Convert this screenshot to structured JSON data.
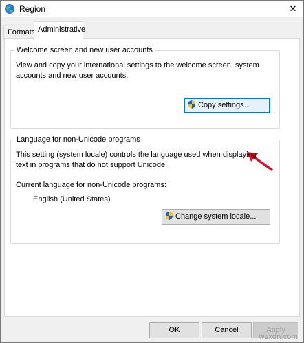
{
  "window": {
    "title": "Region"
  },
  "tabs": [
    {
      "label": "Formats"
    },
    {
      "label": "Administrative"
    }
  ],
  "welcome": {
    "legend": "Welcome screen and new user accounts",
    "description_line1": "View and copy your international settings to the welcome screen, system",
    "description_line2": "accounts and new user accounts.",
    "copy_button_label": "Copy settings..."
  },
  "language": {
    "legend": "Language for non-Unicode programs",
    "description_line1": "This setting (system locale) controls the language used when displaying",
    "description_line2": "text in programs that do not support Unicode.",
    "current_label": "Current language for non-Unicode programs:",
    "current_value": "English (United States)",
    "change_button_label": "Change system locale..."
  },
  "footer": {
    "ok_label": "OK",
    "cancel_label": "Cancel",
    "apply_label": "Apply"
  },
  "watermark": "wsxdn.com",
  "colors": {
    "accent": "#0078d7",
    "annotation_arrow": "#e0102a"
  }
}
